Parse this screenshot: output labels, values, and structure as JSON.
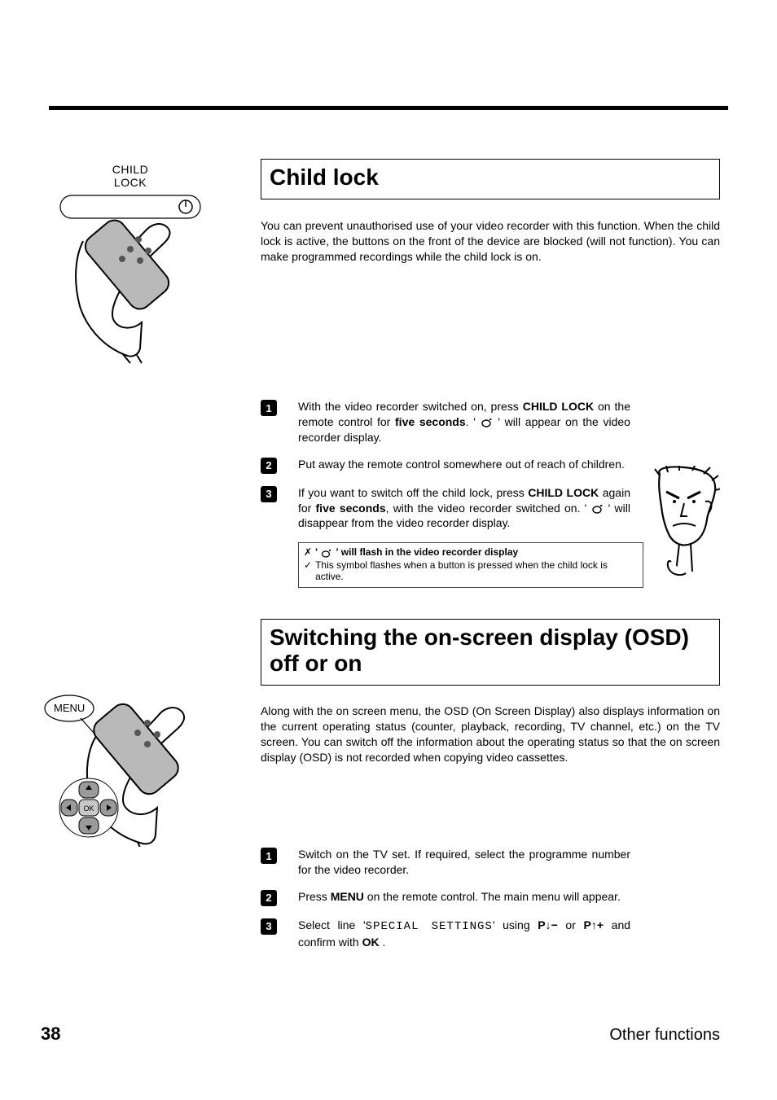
{
  "page_number": "38",
  "footer_label": "Other functions",
  "illustrations": {
    "child_lock_label_1": "CHILD",
    "child_lock_label_2": "LOCK",
    "menu_label": "MENU"
  },
  "section1": {
    "title": "Child lock",
    "intro": "You can prevent unauthorised use of your video recorder with this function. When the child lock is active, the buttons on the front of the device are blocked (will not function). You can make programmed recordings while the child lock is on.",
    "steps": {
      "s1": {
        "num": "1",
        "pre": "With the video recorder switched on, press ",
        "btn": "CHILD LOCK",
        "mid": " on the remote control for ",
        "bold2": "five seconds",
        "post1": ". ' ",
        "post2": " ' will appear on the video recorder display."
      },
      "s2": {
        "num": "2",
        "text": "Put away the remote control somewhere out of reach of children."
      },
      "s3": {
        "num": "3",
        "pre": "If you want to switch off the child lock, press ",
        "btn": "CHILD LOCK",
        "mid": " again for ",
        "bold2": "five seconds",
        "post1": ", with the video recorder switched on. ' ",
        "post2": " ' will disappear from the video recorder display."
      }
    },
    "tip": {
      "l1_pre": "✗",
      "l1_mid": "' ",
      "l1_post": " ' will flash in the video recorder display",
      "l2_pre": "✓",
      "l2_text": "This symbol flashes when a button is pressed when the child lock is active."
    }
  },
  "section2": {
    "title": "Switching the on-screen display (OSD) off or on",
    "intro": "Along with the on screen menu, the OSD (On Screen Display) also displays information on the current operating status (counter, playback, recording, TV channel, etc.) on the TV screen. You can switch off the information about the operating status so that the on screen display (OSD) is not recorded when copying video cassettes.",
    "steps": {
      "s1": {
        "num": "1",
        "text": "Switch on the TV set. If required, select the programme number for the video recorder."
      },
      "s2": {
        "num": "2",
        "pre": "Press ",
        "btn": "MENU",
        "post": " on the remote control. The main menu will appear."
      },
      "s3": {
        "num": "3",
        "pre": "Select line '",
        "mono": "SPECIAL SETTINGS",
        "mid": "' using ",
        "k1": "P",
        "k1sym": "↓−",
        "or": " or ",
        "k2": "P",
        "k2sym": "↑+",
        "post": " and confirm with ",
        "ok": "OK",
        "end": " ."
      }
    }
  }
}
